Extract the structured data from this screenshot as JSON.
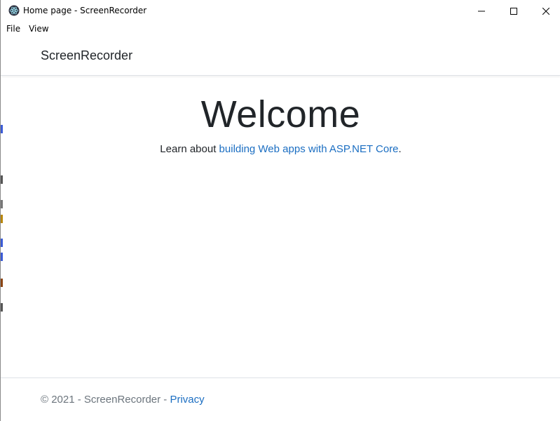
{
  "window": {
    "title": "Home page - ScreenRecorder",
    "icon": "electron-app-icon",
    "controls": {
      "minimize": "minimize-icon",
      "maximize": "maximize-icon",
      "close": "close-icon"
    }
  },
  "menubar": {
    "items": [
      {
        "label": "File"
      },
      {
        "label": "View"
      }
    ]
  },
  "navbar": {
    "brand": "ScreenRecorder"
  },
  "main": {
    "heading": "Welcome",
    "learn_prefix": "Learn about ",
    "learn_link": "building Web apps with ASP.NET Core",
    "learn_suffix": "."
  },
  "footer": {
    "copyright": "© 2021 - ScreenRecorder - ",
    "privacy_link": "Privacy"
  },
  "colors": {
    "link": "#1b6ec2",
    "text": "#212529",
    "muted": "#6c757d",
    "border": "#dee2e6"
  }
}
